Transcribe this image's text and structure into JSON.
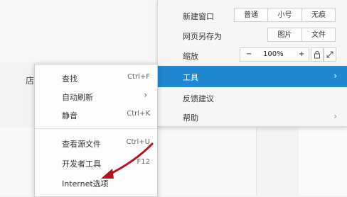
{
  "page": {
    "partial_tab_text": "店"
  },
  "main_menu": {
    "new_window": {
      "label": "新建窗口",
      "btn1": "普通",
      "btn2": "小号",
      "btn3": "无痕"
    },
    "save_as": {
      "label": "网页另存为",
      "btn1": "图片",
      "btn2": "文件"
    },
    "zoom": {
      "label": "缩放",
      "minus": "−",
      "value": "100%",
      "plus": "+",
      "lock_icon": "lock-icon",
      "fullscreen_icon": "expand-icon"
    },
    "tools": {
      "label": "工具",
      "chevron": "›"
    },
    "feedback": {
      "label": "反馈建议"
    },
    "help": {
      "label": "帮助",
      "chevron": "›"
    }
  },
  "sub_menu": {
    "items": [
      {
        "label": "查找",
        "shortcut": "Ctrl+F"
      },
      {
        "label": "自动刷新",
        "shortcut": "›"
      },
      {
        "label": "静音",
        "shortcut": "Ctrl+K"
      },
      {
        "label": "查看源文件",
        "shortcut": "Ctrl+U"
      },
      {
        "label": "开发者工具",
        "shortcut": "F12"
      },
      {
        "label": "Internet选项",
        "shortcut": ""
      }
    ]
  },
  "colors": {
    "accent": "#1e88d2",
    "arrow": "#b3141b"
  }
}
